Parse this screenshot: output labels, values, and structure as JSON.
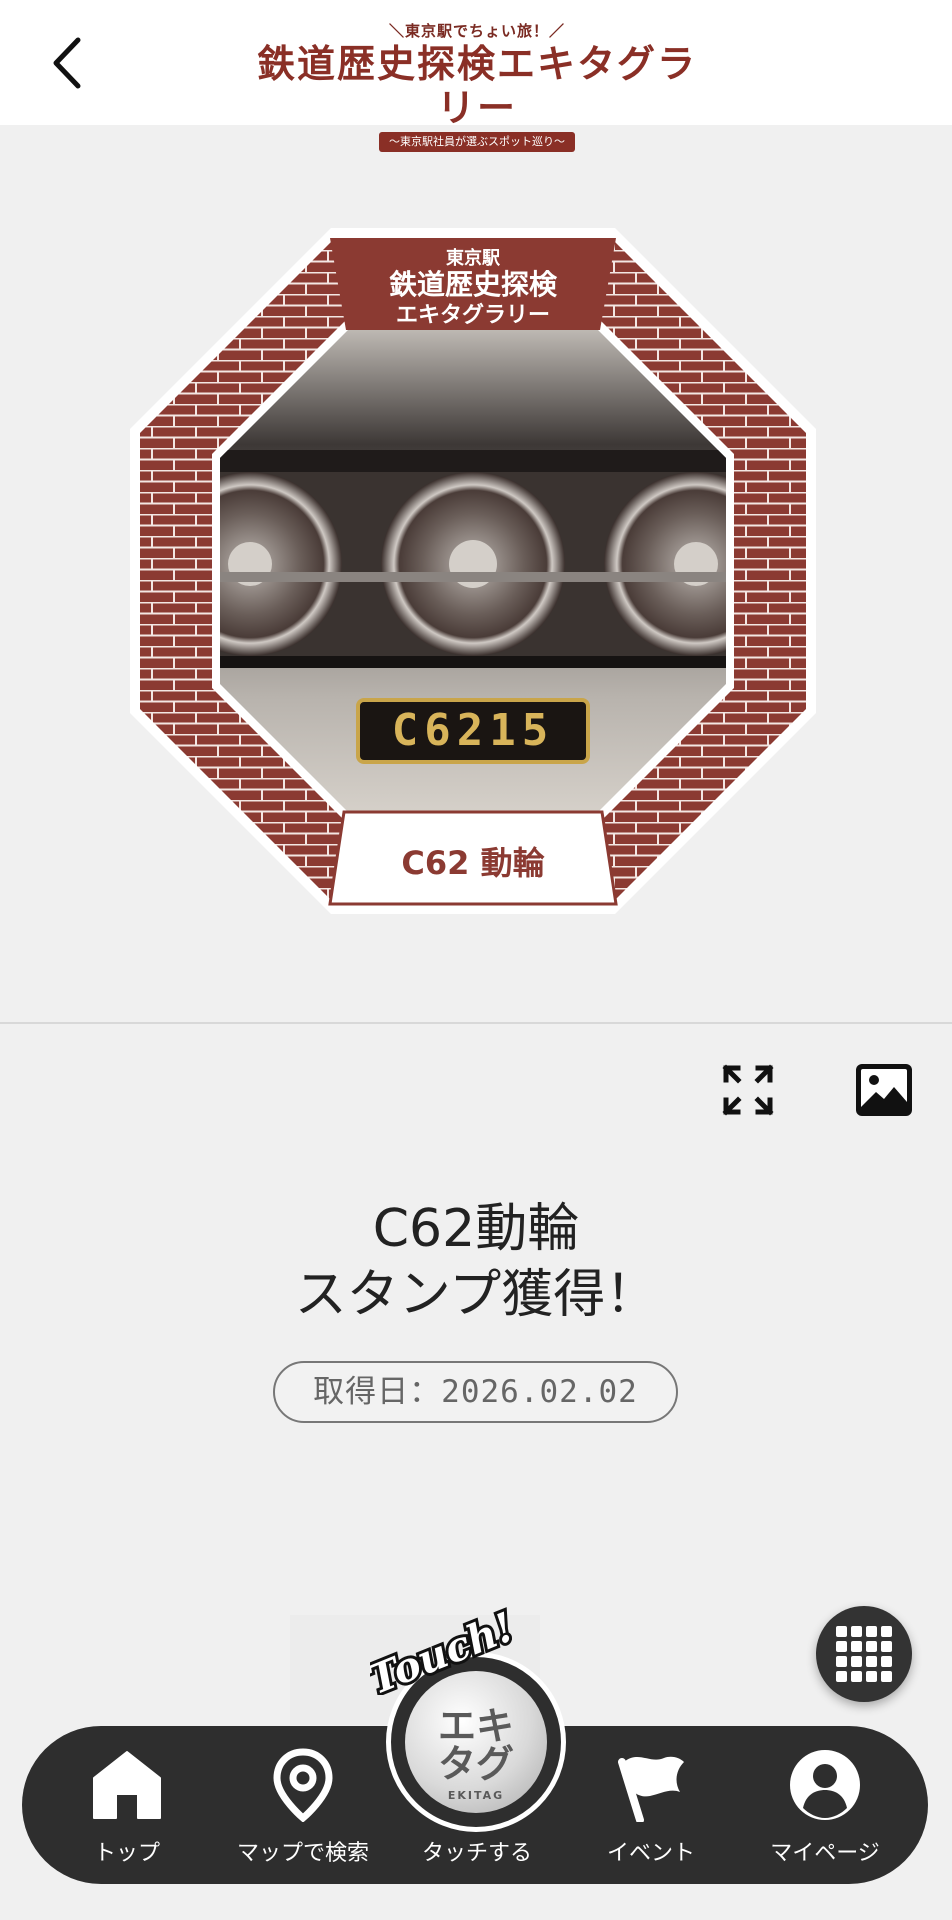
{
  "header": {
    "logo_top": "＼東京駅でちょい旅！／",
    "logo_main": "鉄道歴史探検エキタグラリー",
    "logo_sub": "〜東京駅社員が選ぶスポット巡り〜"
  },
  "stamp": {
    "header_line1": "東京駅",
    "header_line2": "鉄道歴史探検",
    "header_line3": "エキタグラリー",
    "plate": "C6215",
    "caption": "C62 動輪",
    "colors": {
      "brick": "#8b3a32",
      "frame": "#ffffff",
      "photo_dark": "#2a2422"
    }
  },
  "main": {
    "title_line1": "C62動輪",
    "title_line2": "スタンプ獲得！",
    "date_label": "取得日：2026.02.02"
  },
  "touch": {
    "badge_word": "Touch!",
    "badge_main": "エキタグ",
    "badge_sub": "EKITAG"
  },
  "nav": {
    "items": [
      {
        "label": "トップ",
        "icon": "home-icon"
      },
      {
        "label": "マップで検索",
        "icon": "map-pin-icon"
      },
      {
        "label": "タッチする",
        "icon": "touch-badge-icon"
      },
      {
        "label": "イベント",
        "icon": "flag-icon"
      },
      {
        "label": "マイページ",
        "icon": "user-icon"
      }
    ]
  }
}
